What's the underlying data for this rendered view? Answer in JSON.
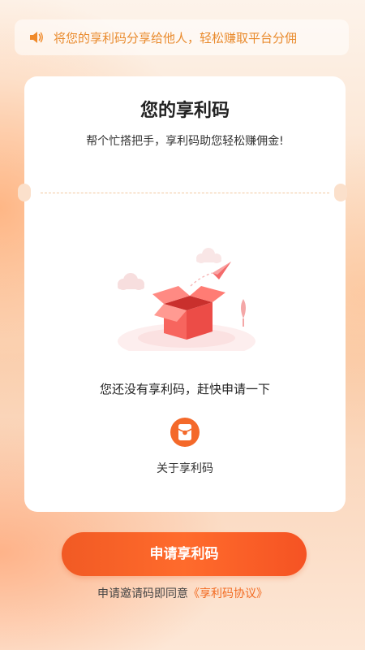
{
  "notice": {
    "icon": "speaker-icon",
    "text": "将您的享利码分享给他人，轻松赚取平台分佣"
  },
  "card": {
    "title": "您的享利码",
    "subtitle": "帮个忙搭把手，享利码助您轻松赚佣金!",
    "empty_text": "您还没有享利码，赶快申请一下",
    "about_label": "关于享利码",
    "about_icon": "red-envelope-icon",
    "illustration_icon": "open-gift-box-with-paper-plane-icon"
  },
  "action": {
    "apply_label": "申请享利码"
  },
  "agreement": {
    "prefix": "申请邀请码即同意",
    "link": "《享利码协议》"
  },
  "colors": {
    "accent": "#f15a24",
    "notice_text": "#e98a2c",
    "link": "#f26b22"
  }
}
